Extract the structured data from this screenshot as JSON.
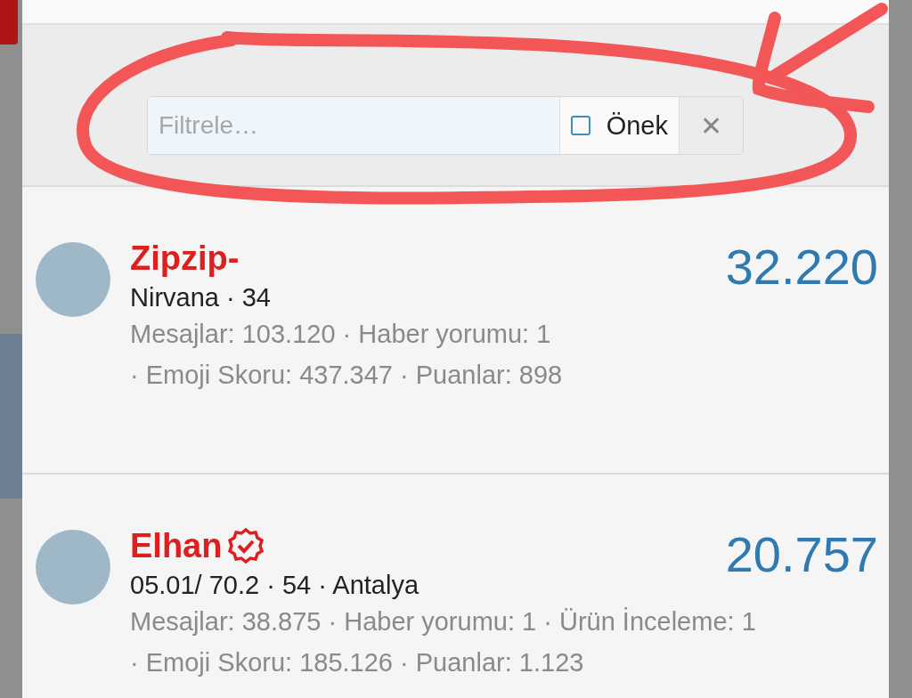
{
  "filter": {
    "placeholder": "Filtrele…",
    "prefix_option": {
      "label": "Önek",
      "checked": false
    },
    "clear_button": "✕"
  },
  "members": [
    {
      "name": "Zipzip-",
      "verified": false,
      "score": "32.220",
      "subtitle": "Nirvana · 34",
      "stats": [
        "Mesajlar: 103.120",
        "· Haber yorumu: 1",
        "· Emoji Skoru: 437.347",
        "· Puanlar: 898"
      ]
    },
    {
      "name": "Elhan",
      "verified": true,
      "score": "20.757",
      "subtitle": "05.01/ 70.2 · 54 · Antalya",
      "stats": [
        "Mesajlar: 38.875",
        "· Haber yorumu: 1",
        "· Ürün İnceleme: 1",
        "· Emoji Skoru: 185.126",
        "· Puanlar: 1.123"
      ]
    }
  ]
}
